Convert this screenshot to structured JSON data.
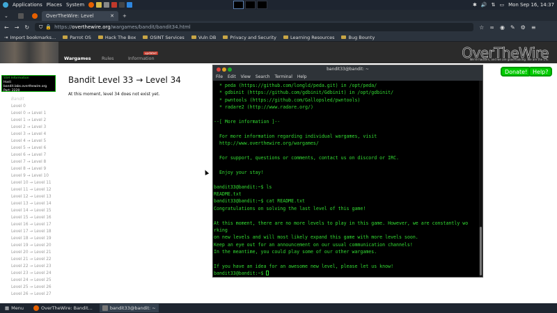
{
  "system_panel": {
    "menus": [
      "Applications",
      "Places",
      "System"
    ],
    "clock": "Mon Sep 16, 14:37"
  },
  "browser": {
    "tab_title": "OverTheWire: Level",
    "url_prefix": "https://",
    "url_domain": "overthewire.org",
    "url_path": "/wargames/bandit/bandit34.html",
    "bookmarks": [
      "Import bookmarks...",
      "Parrot OS",
      "Hack The Box",
      "OSINT Services",
      "Vuln DB",
      "Privacy and Security",
      "Learning Resources",
      "Bug Bounty"
    ]
  },
  "site": {
    "nav": [
      "Wargames",
      "Rules",
      "Information"
    ],
    "updated_badge": "updated",
    "logo": "OverTheWire",
    "tagline": "We're hackers, and we are good-looking. We are the 1%.",
    "donate": "Donate!",
    "help": "Help?",
    "ssh_title": "SSH Information",
    "ssh_host": "Host: bandit.labs.overthewire.org",
    "ssh_port": "Port: 2220",
    "page_title": "Bandit Level 33 → Level 34",
    "page_desc": "At this moment, level 34 does not exist yet.",
    "levels_head": "Bandit",
    "levels": [
      "Level 0",
      "Level 0 → Level 1",
      "Level 1 → Level 2",
      "Level 2 → Level 3",
      "Level 3 → Level 4",
      "Level 4 → Level 5",
      "Level 5 → Level 6",
      "Level 6 → Level 7",
      "Level 7 → Level 8",
      "Level 8 → Level 9",
      "Level 9 → Level 10",
      "Level 10 → Level 11",
      "Level 11 → Level 12",
      "Level 12 → Level 13",
      "Level 13 → Level 14",
      "Level 14 → Level 15",
      "Level 15 → Level 16",
      "Level 16 → Level 17",
      "Level 17 → Level 18",
      "Level 18 → Level 19",
      "Level 19 → Level 20",
      "Level 20 → Level 21",
      "Level 21 → Level 22",
      "Level 22 → Level 23",
      "Level 23 → Level 24",
      "Level 24 → Level 25",
      "Level 25 → Level 26",
      "Level 26 → Level 27"
    ]
  },
  "terminal": {
    "title": "bandit33@bandit: ~",
    "menu": [
      "File",
      "Edit",
      "View",
      "Search",
      "Terminal",
      "Help"
    ],
    "lines": [
      "  * peda (https://github.com/longld/peda.git) in /opt/peda/",
      "  * gdbinit (https://github.com/gdbinit/Gdbinit) in /opt/gdbinit/",
      "  * pwntools (https://github.com/Gallopsled/pwntools)",
      "  * radare2 (http://www.radare.org/)",
      "",
      "--[ More information ]--",
      "",
      "  For more information regarding individual wargames, visit",
      "  http://www.overthewire.org/wargames/",
      "",
      "  For support, questions or comments, contact us on discord or IRC.",
      "",
      "  Enjoy your stay!",
      "",
      "bandit33@bandit:~$ ls",
      "README.txt",
      "bandit33@bandit:~$ cat README.txt",
      "Congratulations on solving the last level of this game!",
      "",
      "At this moment, there are no more levels to play in this game. However, we are constantly wo",
      "rking",
      "on new levels and will most likely expand this game with more levels soon.",
      "Keep an eye out for an announcement on our usual communication channels!",
      "In the meantime, you could play some of our other wargames.",
      "",
      "If you have an idea for an awesome new level, please let us know!"
    ],
    "prompt": "bandit33@bandit:~$ "
  },
  "taskbar": {
    "menu": "Menu",
    "items": [
      "OverTheWire: Bandit...",
      "bandit33@bandit: ~"
    ]
  },
  "colors": {
    "terminal_text": "#33dd33",
    "button_green": "#00cc00"
  }
}
